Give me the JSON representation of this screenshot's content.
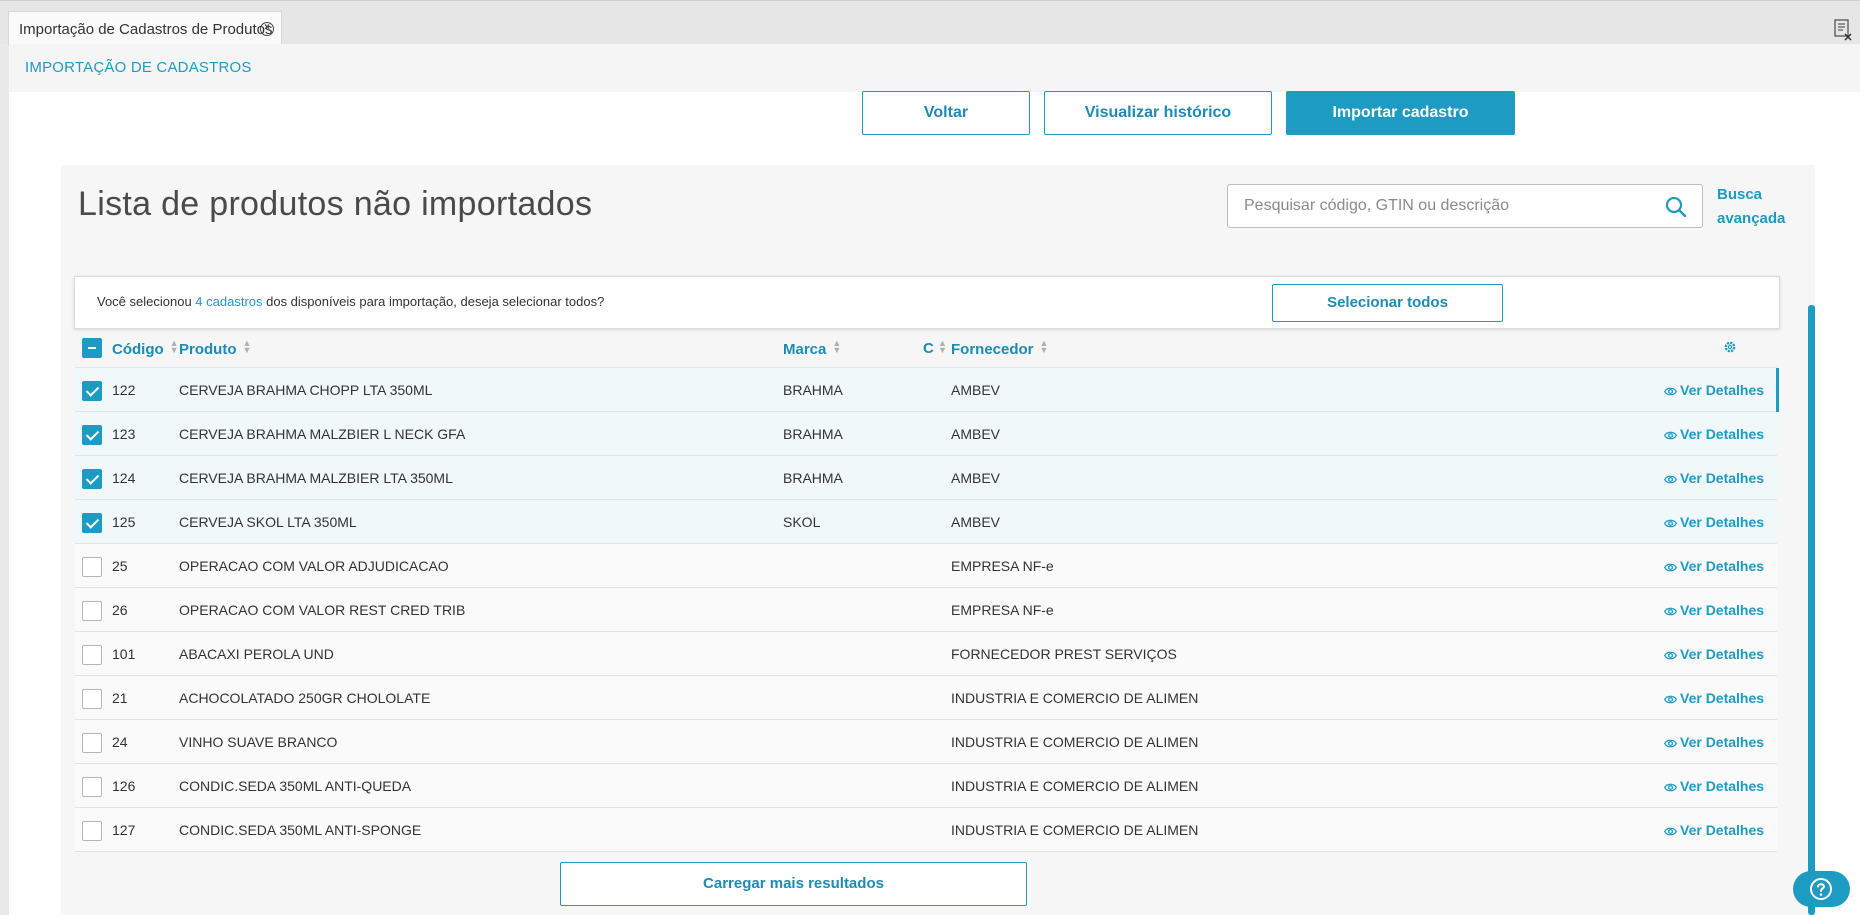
{
  "tab": {
    "label": "Importação de Cadastros de Produtos"
  },
  "subheader": {
    "title": "IMPORTAÇÃO DE CADASTROS"
  },
  "actions": {
    "voltar": "Voltar",
    "historico": "Visualizar histórico",
    "importar": "Importar cadastro"
  },
  "panel": {
    "title": "Lista de produtos não importados",
    "search_placeholder": "Pesquisar código, GTIN ou descrição",
    "advanced_search": "Busca avançada"
  },
  "banner": {
    "prefix": "Você selecionou ",
    "count": "4 cadastros",
    "suffix": " dos disponíveis para importação, deseja selecionar todos?",
    "select_all": "Selecionar todos"
  },
  "table": {
    "columns": {
      "codigo": "Código",
      "produto": "Produto",
      "marca": "Marca",
      "hidden": "C",
      "fornecedor": "Fornecedor"
    },
    "details_label": "Ver Detalhes",
    "rows": [
      {
        "selected": true,
        "codigo": "122",
        "produto": "CERVEJA BRAHMA CHOPP LTA 350ML",
        "marca": "BRAHMA",
        "fornecedor": "AMBEV"
      },
      {
        "selected": true,
        "codigo": "123",
        "produto": "CERVEJA BRAHMA MALZBIER L NECK GFA",
        "marca": "BRAHMA",
        "fornecedor": "AMBEV"
      },
      {
        "selected": true,
        "codigo": "124",
        "produto": "CERVEJA BRAHMA MALZBIER LTA 350ML",
        "marca": "BRAHMA",
        "fornecedor": "AMBEV"
      },
      {
        "selected": true,
        "codigo": "125",
        "produto": "CERVEJA SKOL LTA 350ML",
        "marca": "SKOL",
        "fornecedor": "AMBEV"
      },
      {
        "selected": false,
        "codigo": "25",
        "produto": "OPERACAO COM VALOR ADJUDICACAO",
        "marca": "",
        "fornecedor": "EMPRESA NF-e"
      },
      {
        "selected": false,
        "codigo": "26",
        "produto": "OPERACAO COM VALOR REST CRED TRIB",
        "marca": "",
        "fornecedor": "EMPRESA NF-e"
      },
      {
        "selected": false,
        "codigo": "101",
        "produto": "ABACAXI PEROLA UND",
        "marca": "",
        "fornecedor": "FORNECEDOR PREST SERVIÇOS"
      },
      {
        "selected": false,
        "codigo": "21",
        "produto": "ACHOCOLATADO 250GR CHOLOLATE",
        "marca": "",
        "fornecedor": "INDUSTRIA E COMERCIO DE ALIMEN"
      },
      {
        "selected": false,
        "codigo": "24",
        "produto": "VINHO SUAVE BRANCO",
        "marca": "",
        "fornecedor": "INDUSTRIA E COMERCIO DE ALIMEN"
      },
      {
        "selected": false,
        "codigo": "126",
        "produto": "CONDIC.SEDA 350ML ANTI-QUEDA",
        "marca": "",
        "fornecedor": "INDUSTRIA E COMERCIO DE ALIMEN"
      },
      {
        "selected": false,
        "codigo": "127",
        "produto": "CONDIC.SEDA 350ML ANTI-SPONGE",
        "marca": "",
        "fornecedor": "INDUSTRIA E COMERCIO DE ALIMEN"
      }
    ]
  },
  "load_more": "Carregar mais resultados",
  "colors": {
    "accent": "#1d9bc3",
    "selected_row": "#f1f8fa"
  },
  "icons": [
    "close-circle-icon",
    "window-close-icon",
    "search-icon",
    "settings-icon",
    "eye-icon",
    "help-icon"
  ]
}
